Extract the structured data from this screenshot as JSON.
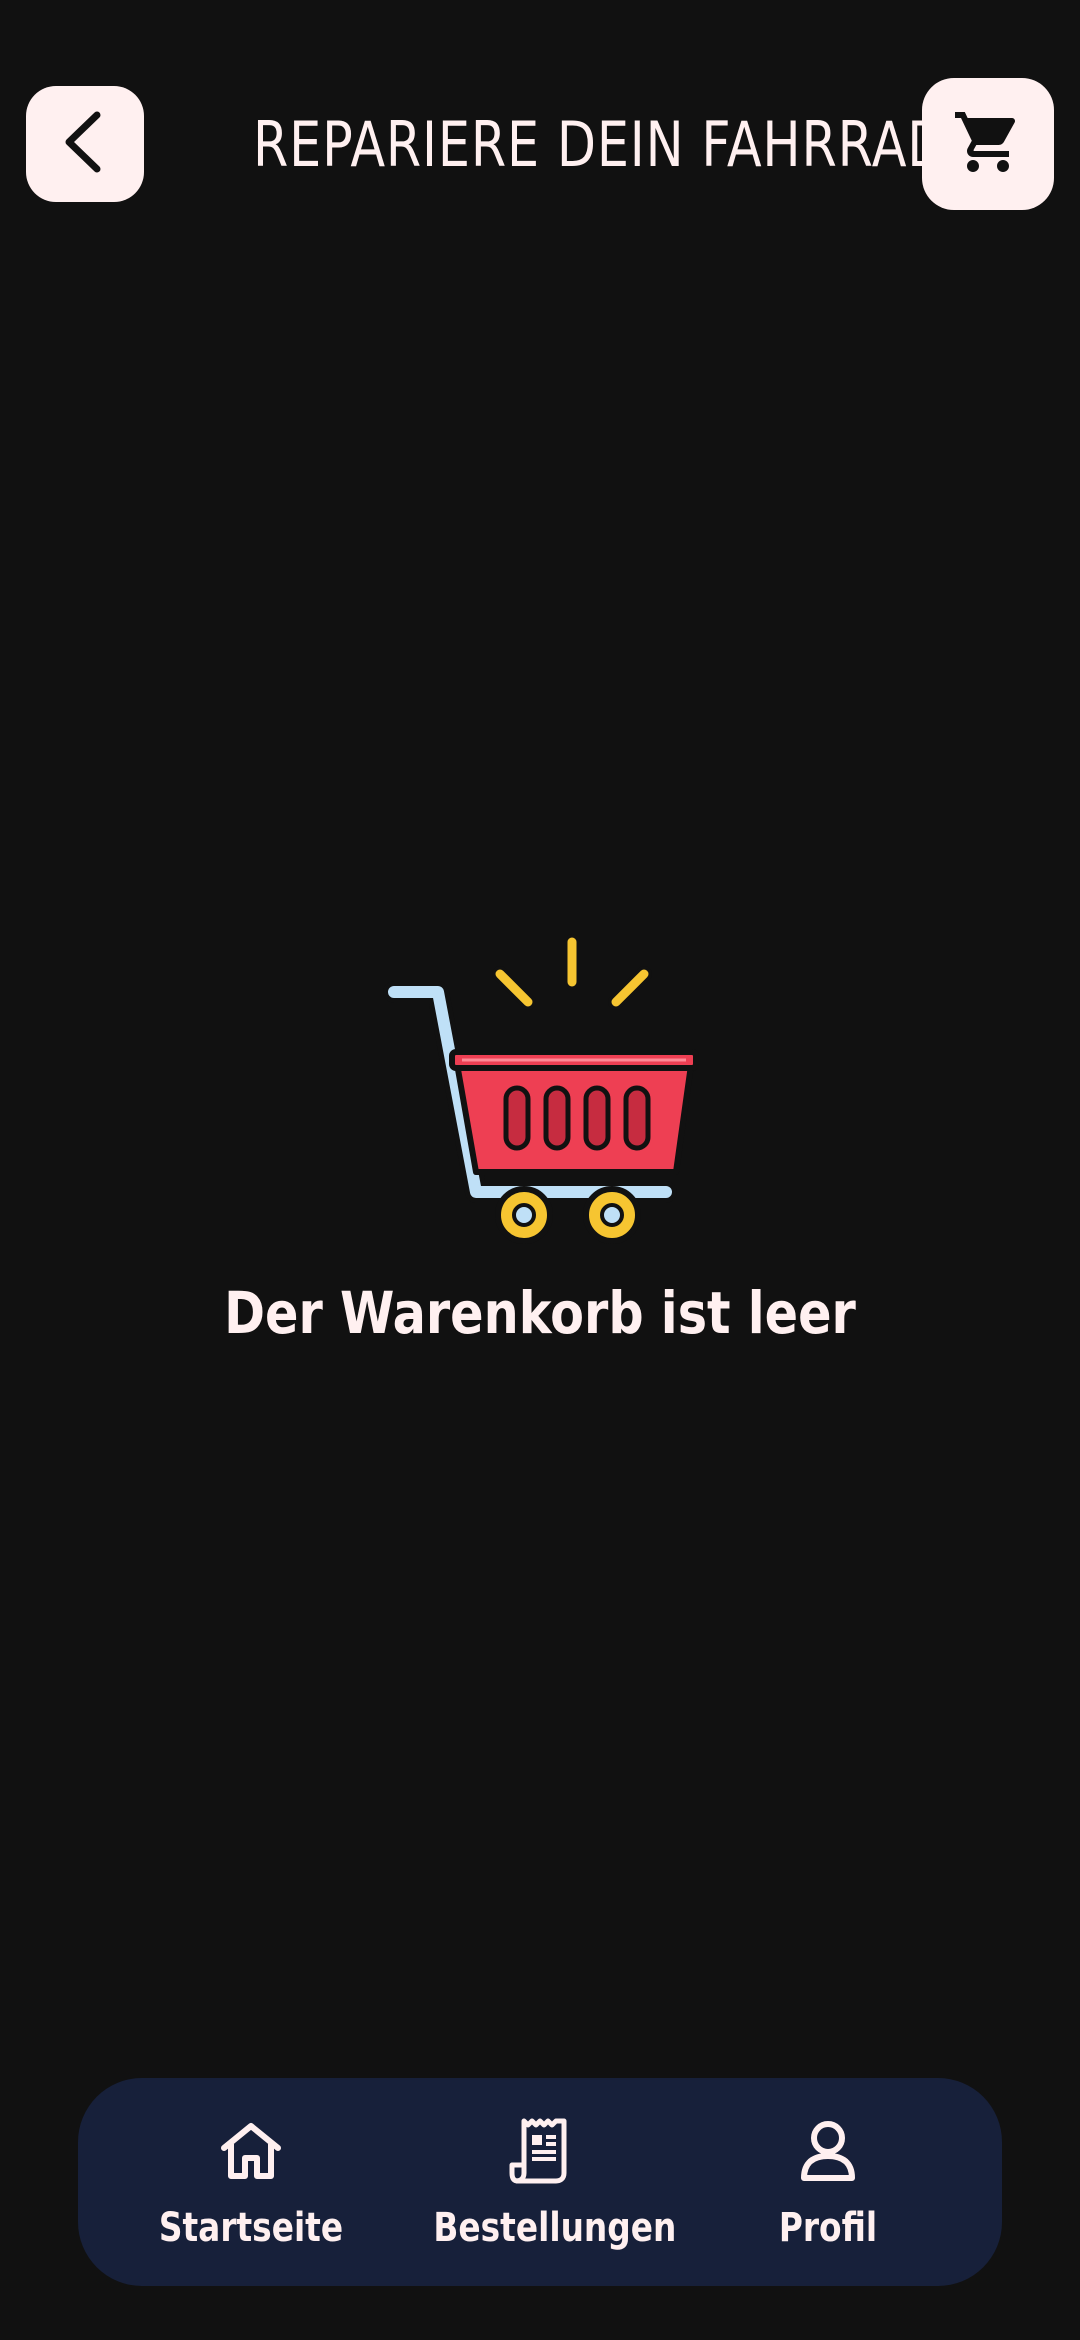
{
  "header": {
    "title": "REPARIERE DEIN FAHRRAD",
    "back_icon": "chevron-left-icon",
    "cart_icon": "shopping-cart-icon"
  },
  "empty_state": {
    "icon": "empty-cart-illustration",
    "message": "Der Warenkorb ist leer"
  },
  "bottom_nav": {
    "items": [
      {
        "label": "Startseite",
        "icon": "home-icon"
      },
      {
        "label": "Bestellungen",
        "icon": "receipt-icon"
      },
      {
        "label": "Profil",
        "icon": "user-icon"
      }
    ]
  },
  "colors": {
    "background": "#111111",
    "text": "#FFF0F0",
    "button_bg": "#FFF0F0",
    "nav_bg": "#17203A",
    "cart_red": "#EE3F53",
    "cart_frame": "#BFE0F7",
    "accent_yellow": "#F6C531"
  }
}
